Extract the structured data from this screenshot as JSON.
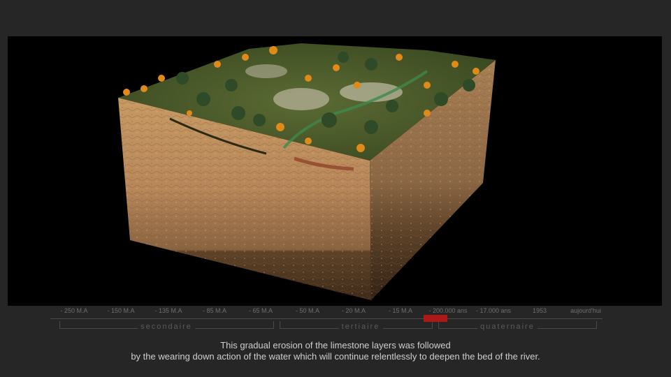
{
  "viewport": {
    "scene": "limestone-terrain-block-3d"
  },
  "timeline": {
    "ticks": [
      "- 250 M.A",
      "- 150 M.A",
      "- 135 M.A",
      "- 85 M.A",
      "- 65 M.A",
      "- 50 M.A",
      "- 20 M.A",
      "- 15 M.A",
      "- 200.000 ans",
      "- 17.000 ans",
      "1953",
      "aujourd'hui"
    ],
    "eras": [
      "secondaire",
      "tertiaire",
      "quaternaire"
    ],
    "current_index": 8,
    "marker_color": "#b01818"
  },
  "subtitle": {
    "line1": "This gradual erosion of the limestone layers was followed",
    "line2": "by the wearing down action of the water which will continue relentlessly to deepen the bed of the river."
  }
}
